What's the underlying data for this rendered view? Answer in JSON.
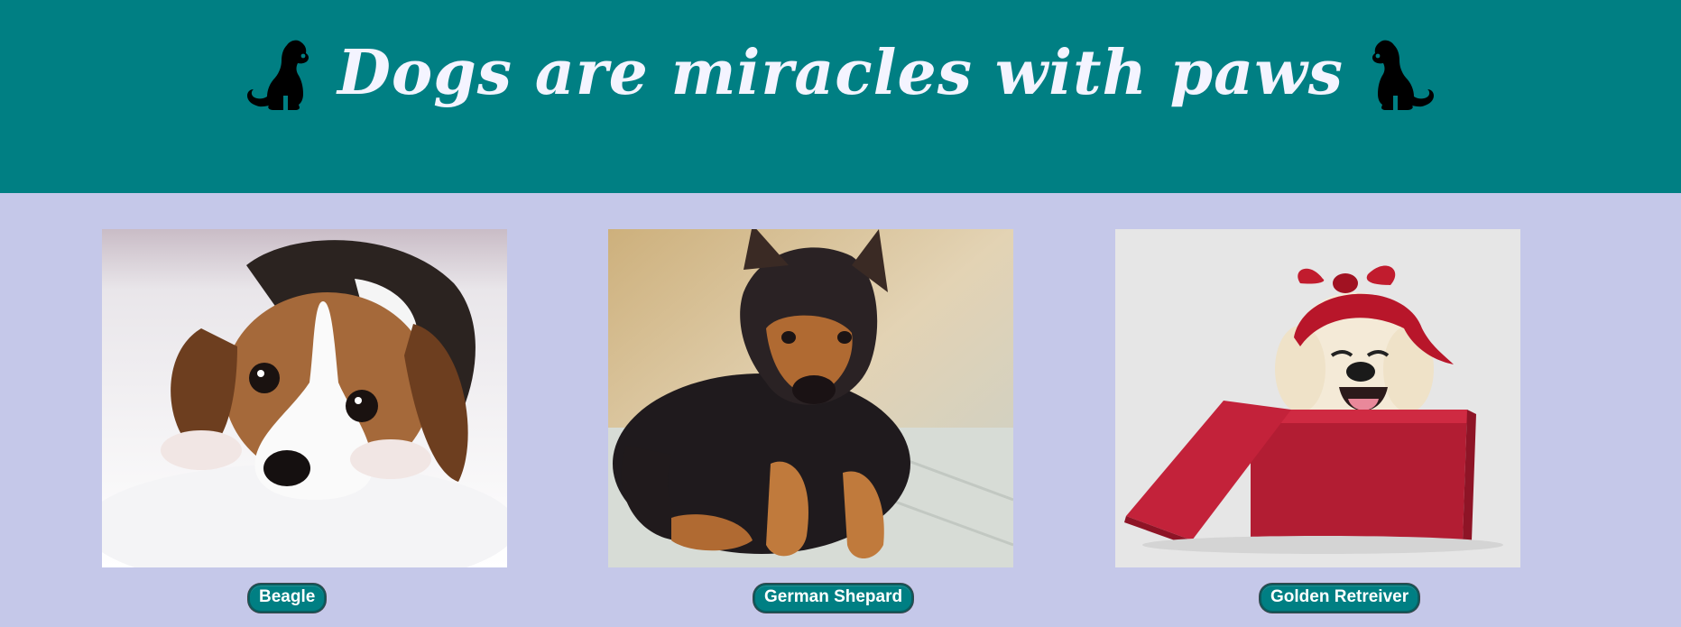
{
  "colors": {
    "header_bg": "#007f83",
    "page_bg": "#c5c8e9",
    "button_bg": "#007f83",
    "title_text": "#f4f4ff"
  },
  "header": {
    "title": "Dogs are miracles with paws",
    "left_icon": "sitting-dog-silhouette-icon",
    "right_icon": "sitting-dog-silhouette-icon"
  },
  "gallery": {
    "items": [
      {
        "label": "Beagle",
        "photo": "beagle-puppy-photo"
      },
      {
        "label": "German Shepard",
        "photo": "german-shepherd-puppy-photo"
      },
      {
        "label": "Golden Retreiver",
        "photo": "golden-retriever-puppy-photo"
      }
    ]
  }
}
